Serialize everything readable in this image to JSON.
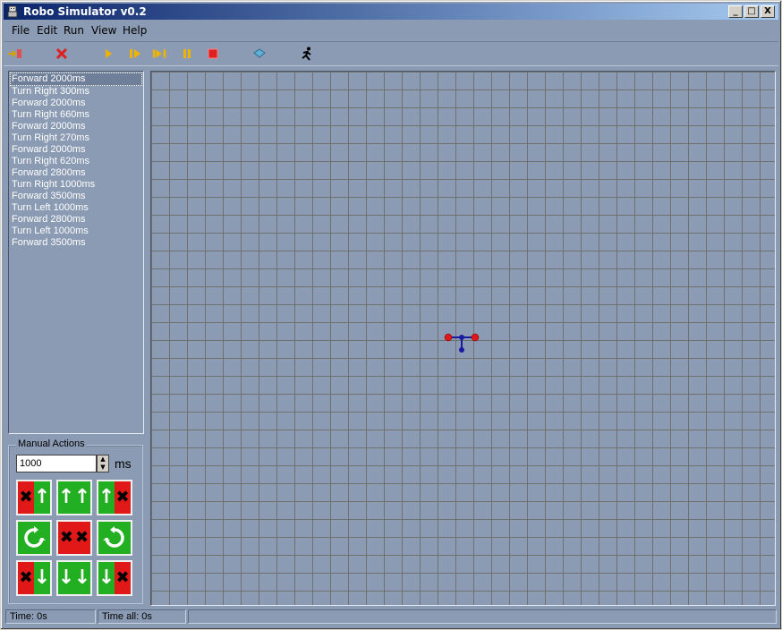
{
  "window": {
    "title": "Robo Simulator v0.2",
    "minimize_label": "_",
    "maximize_label": "□",
    "close_label": "X"
  },
  "menu": [
    "File",
    "Edit",
    "Run",
    "View",
    "Help"
  ],
  "toolbar": {
    "icons": [
      "import-icon",
      "delete-icon",
      "play-icon",
      "step-icon",
      "step-end-icon",
      "pause-icon",
      "stop-icon",
      "book-icon",
      "runner-icon"
    ]
  },
  "commands": [
    "Forward 2000ms",
    "Turn Right 300ms",
    "Forward 2000ms",
    "Turn Right 660ms",
    "Forward 2000ms",
    "Turn Right 270ms",
    "Forward 2000ms",
    "Turn Right 620ms",
    "Forward 2800ms",
    "Turn Right 1000ms",
    "Forward 3500ms",
    "Turn Left 1000ms",
    "Forward 2800ms",
    "Turn Left 1000ms",
    "Forward 3500ms"
  ],
  "manual": {
    "legend": "Manual Actions",
    "duration_value": "1000",
    "unit": "ms"
  },
  "status": {
    "time": "Time: 0s",
    "time_all": "Time all: 0s"
  },
  "colors": {
    "background": "#8a9bb3",
    "motor_on": "#22b022",
    "motor_off": "#e01818",
    "robot_wheel": "#e01818",
    "robot_body": "#1a1aa0"
  }
}
